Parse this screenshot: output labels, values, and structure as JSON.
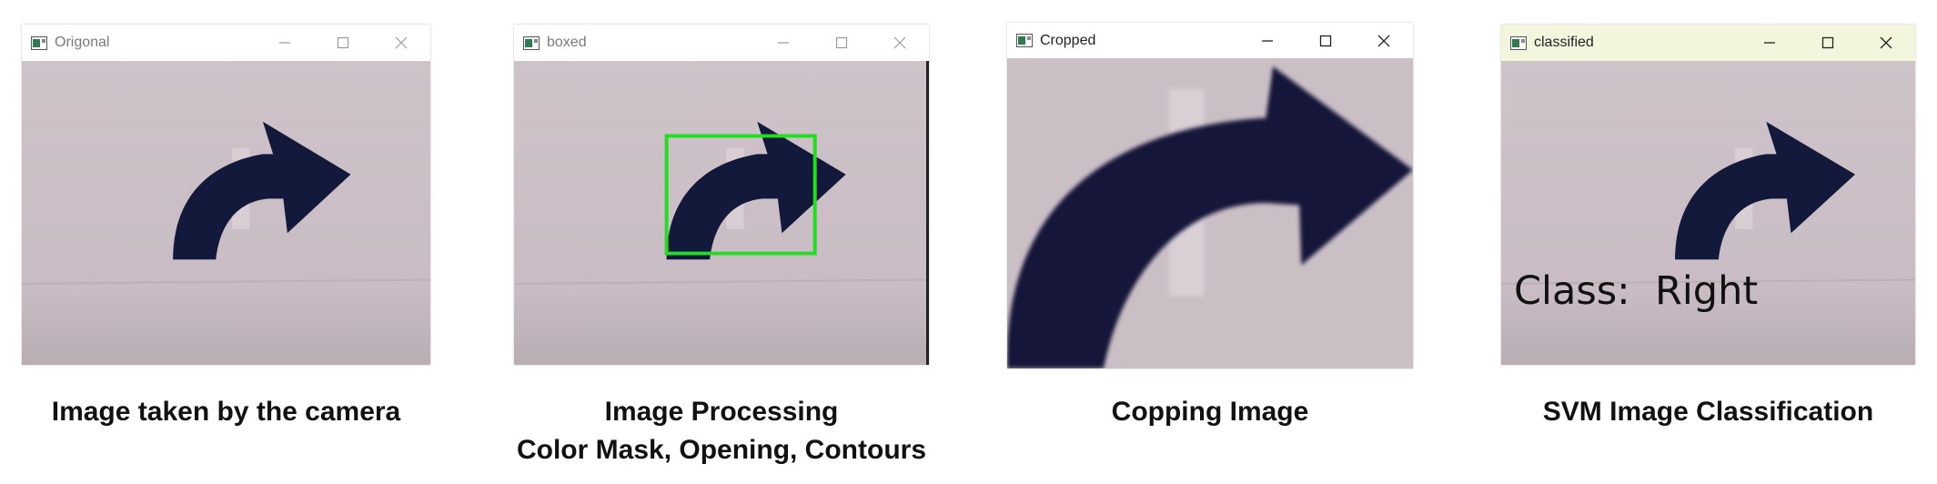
{
  "colors": {
    "backdrop": "#ccbfc7",
    "arrow": "#13193a",
    "bounding_box": "#22dd22",
    "titlebar": "#ffffff",
    "titlebar_active": "#f3f5dc"
  },
  "windows": [
    {
      "title": "Origonal",
      "caption": "Image taken by the camera",
      "caption_line2": ""
    },
    {
      "title": "boxed",
      "caption": "Image Processing",
      "caption_line2": "Color Mask, Opening, Contours"
    },
    {
      "title": "Cropped",
      "caption": "Copping Image",
      "caption_line2": ""
    },
    {
      "title": "classified",
      "caption": "SVM Image Classification",
      "caption_line2": "",
      "overlay_text": "Class:  Right"
    }
  ],
  "icons": {
    "app": "opencv-window-icon",
    "minimize": "minimize-icon",
    "maximize": "maximize-icon",
    "close": "close-icon"
  }
}
